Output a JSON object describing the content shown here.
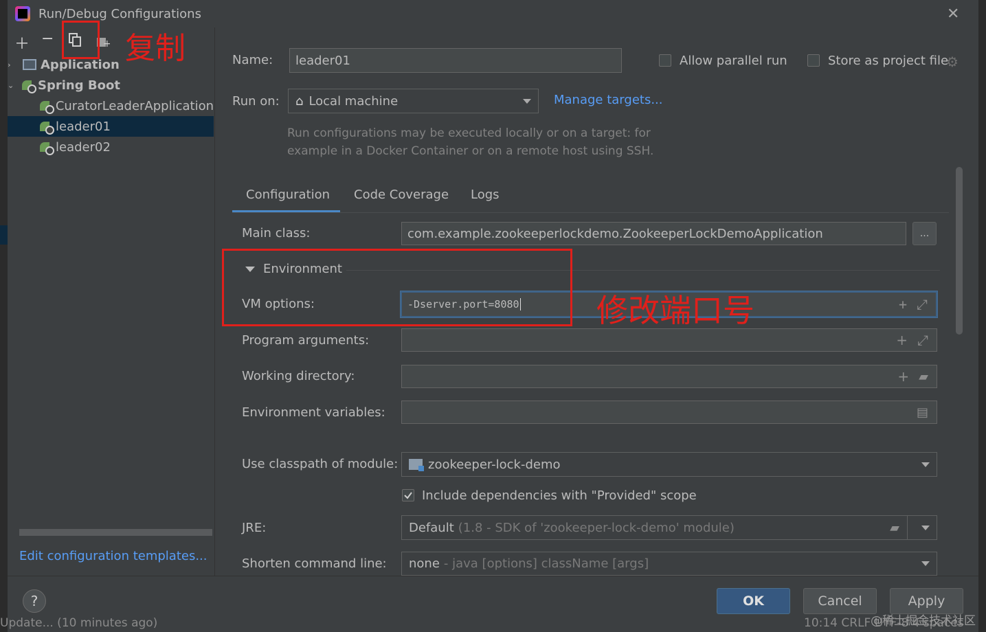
{
  "window": {
    "title": "Run/Debug Configurations",
    "close_icon": "close-icon"
  },
  "annotations": {
    "copy_label": "复制",
    "port_label": "修改端口号"
  },
  "sidebar": {
    "tree": [
      {
        "label": "Application",
        "icon": "application-icon"
      },
      {
        "label": "Spring Boot",
        "icon": "spring-boot-icon"
      },
      {
        "label": "CuratorLeaderApplication",
        "icon": "spring-boot-icon"
      },
      {
        "label": "leader01",
        "icon": "spring-boot-icon",
        "selected": true
      },
      {
        "label": "leader02",
        "icon": "spring-boot-icon"
      }
    ],
    "edit_templates_link": "Edit configuration templates..."
  },
  "form": {
    "name_label": "Name:",
    "name_value": "leader01",
    "allow_parallel_label": "Allow parallel run",
    "store_project_label": "Store as project file",
    "run_on_label": "Run on:",
    "run_on_value": "Local machine",
    "manage_targets": "Manage targets...",
    "hint_line1": "Run configurations may be executed locally or on a target: for",
    "hint_line2": "example in a Docker Container or on a remote host using SSH."
  },
  "tabs": [
    "Configuration",
    "Code Coverage",
    "Logs"
  ],
  "config": {
    "main_class_label": "Main class:",
    "main_class_value": "com.example.zookeeperlockdemo.ZookeeperLockDemoApplication",
    "browse_button": "...",
    "environment_label": "Environment",
    "vm_options_label": "VM options:",
    "vm_options_value": "-Dserver.port=8080",
    "program_args_label": "Program arguments:",
    "working_dir_label": "Working directory:",
    "env_vars_label": "Environment variables:",
    "classpath_label": "Use classpath of module:",
    "classpath_value": "zookeeper-lock-demo",
    "include_deps_label": "Include dependencies with \"Provided\" scope",
    "jre_label": "JRE:",
    "jre_value_main": "Default",
    "jre_value_detail": "(1.8 - SDK of 'zookeeper-lock-demo' module)",
    "shorten_label": "Shorten command line:",
    "shorten_value_main": "none",
    "shorten_value_detail": "- java [options] className [args]"
  },
  "buttons": {
    "ok": "OK",
    "cancel": "Cancel",
    "apply": "Apply",
    "help": "?"
  },
  "status_bar": {
    "left": "Update... (10 minutes ago)",
    "right": "10:14   CRLF   UTF-8   4 spaces"
  },
  "watermark": "@稀土掘金技术社区",
  "colors": {
    "accent": "#589df6",
    "selection": "#0d293e",
    "annotation": "#e0201b",
    "primary_button": "#365880"
  }
}
